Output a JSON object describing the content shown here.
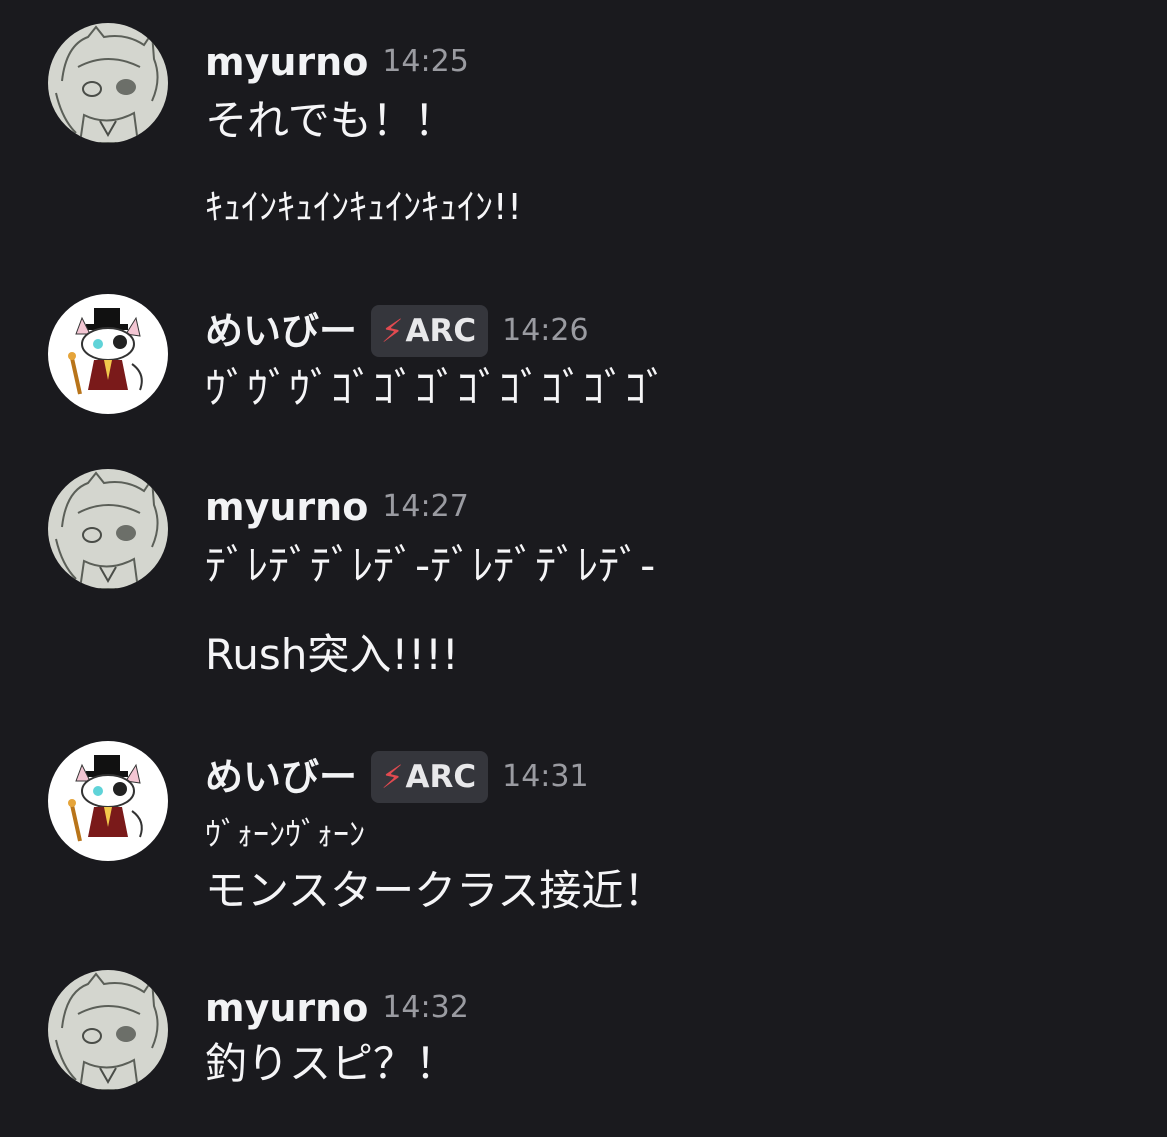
{
  "messages": [
    {
      "author": "myurno",
      "time": "14:25",
      "lines": [
        "それでも！！",
        "ｷｭｲﾝｷｭｲﾝｷｭｲﾝｷｭｲﾝ!!"
      ]
    },
    {
      "author": "めいびー",
      "badge": "ARC",
      "badge_icon": "lightning-icon",
      "time": "14:26",
      "lines": [
        "ｳﾞｳﾞｳﾞｺﾞｺﾞｺﾞｺﾞｺﾞｺﾞｺﾞｺﾞ"
      ]
    },
    {
      "author": "myurno",
      "time": "14:27",
      "lines": [
        "ﾃﾞﾚﾃﾞﾃﾞﾚﾃﾞ-ﾃﾞﾚﾃﾞﾃﾞﾚﾃﾞ-",
        "Rush突入!!!!"
      ]
    },
    {
      "author": "めいびー",
      "badge": "ARC",
      "badge_icon": "lightning-icon",
      "time": "14:31",
      "lines": [
        "ｳﾞｫｰﾝｳﾞｫｰﾝ",
        "モンスタークラス接近！"
      ]
    },
    {
      "author": "myurno",
      "time": "14:32",
      "lines": [
        "釣りスピ？！"
      ]
    }
  ],
  "colors": {
    "background": "#1a1a1e",
    "username": "#f2f3f5",
    "timestamp": "#9a9ba1",
    "badge_bg": "#35363c",
    "badge_icon": "#e14a50"
  }
}
